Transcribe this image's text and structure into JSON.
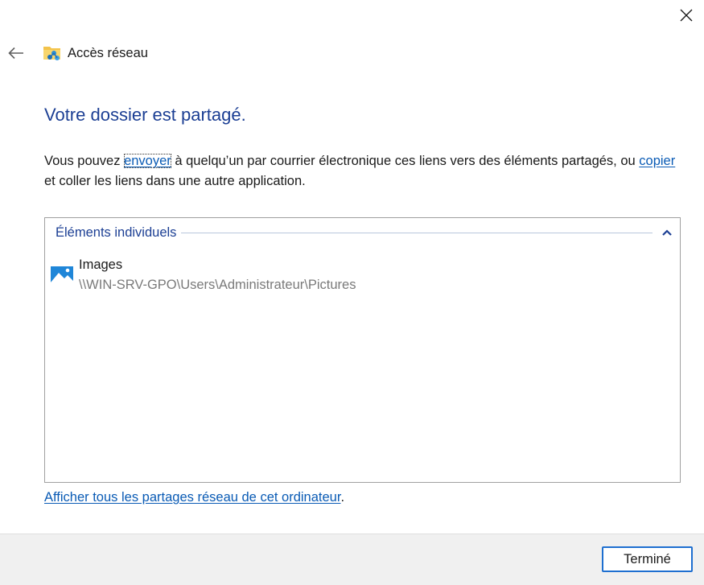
{
  "window": {
    "title": "Accès réseau",
    "title_icon": "network-folder-icon",
    "close_icon": "close-icon",
    "back_icon": "back-arrow-icon"
  },
  "heading": "Votre dossier est partagé.",
  "description": {
    "part1": "Vous pouvez ",
    "send_link": "envoyer",
    "part2": " à quelqu’un par courrier électronique ces liens vers des éléments partagés, ou ",
    "copy_link": "copier",
    "part3": " et coller les liens dans une autre application."
  },
  "items_group": {
    "label": "Éléments individuels",
    "collapse_icon": "chevron-up-icon",
    "items": [
      {
        "name": "Images",
        "path": "\\\\WIN-SRV-GPO\\Users\\Administrateur\\Pictures",
        "icon": "pictures-folder-icon"
      }
    ]
  },
  "show_all": {
    "link": "Afficher tous les partages réseau de cet ordinateur",
    "suffix": "."
  },
  "footer": {
    "done_label": "Terminé"
  },
  "colors": {
    "heading": "#1c3f94",
    "link": "#0a5bb5",
    "path_text": "#7a7a7a",
    "footer_bg": "#f0f0f0",
    "button_border": "#1e6fd0"
  }
}
